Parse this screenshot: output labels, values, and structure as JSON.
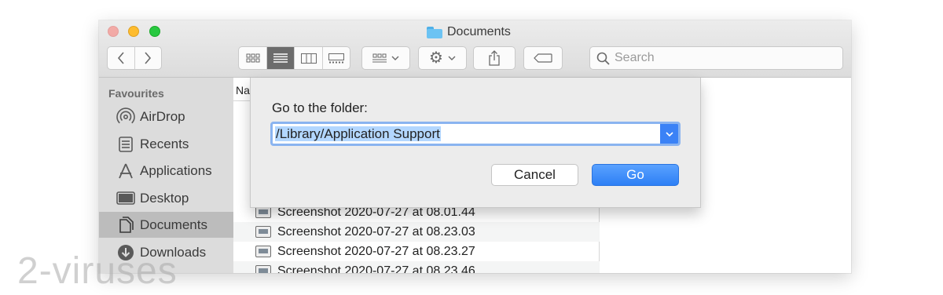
{
  "window": {
    "title": "Documents"
  },
  "toolbar": {
    "back_icon": "chevron-left-icon",
    "forward_icon": "chevron-right-icon",
    "view_modes": [
      "icon-view",
      "list-view",
      "column-view",
      "gallery-view"
    ],
    "active_view": "list-view",
    "search_placeholder": "Search"
  },
  "sidebar": {
    "heading": "Favourites",
    "items": [
      {
        "label": "AirDrop",
        "icon": "airdrop-icon"
      },
      {
        "label": "Recents",
        "icon": "recents-icon"
      },
      {
        "label": "Applications",
        "icon": "applications-icon"
      },
      {
        "label": "Desktop",
        "icon": "desktop-icon"
      },
      {
        "label": "Documents",
        "icon": "documents-icon",
        "selected": true
      },
      {
        "label": "Downloads",
        "icon": "downloads-icon"
      }
    ]
  },
  "filelist": {
    "header_name": "Na",
    "rows": [
      "Screenshot 2020-07-27 at 08.01.44",
      "Screenshot 2020-07-27 at 08.23.03",
      "Screenshot 2020-07-27 at 08.23.27",
      "Screenshot 2020-07-27 at 08.23.46"
    ]
  },
  "goto_dialog": {
    "label": "Go to the folder:",
    "path_value": "/Library/Application Support",
    "cancel_label": "Cancel",
    "go_label": "Go"
  },
  "watermark": "2-viruses",
  "colors": {
    "accent": "#3b82f6",
    "selection": "#b3d7ff",
    "close": "#ff5f57",
    "minimize": "#febc2e",
    "maximize": "#28c840"
  }
}
